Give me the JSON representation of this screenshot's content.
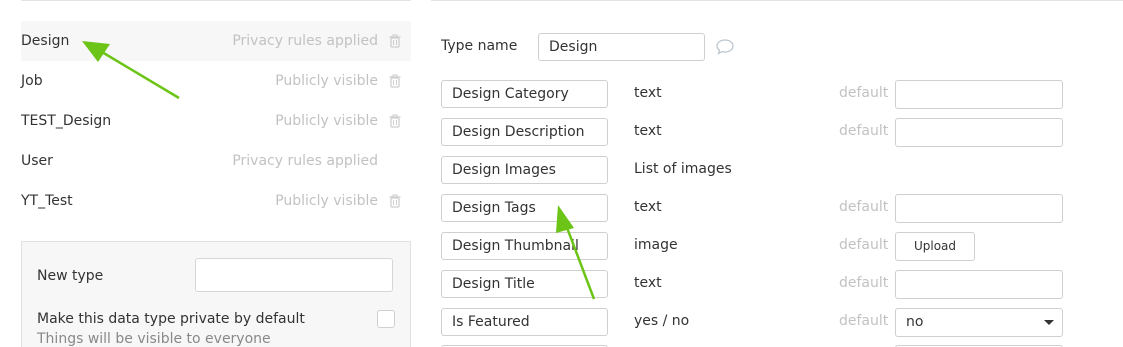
{
  "type_list": {
    "items": [
      {
        "name": "Design",
        "status": "Privacy rules applied",
        "has_trash": true
      },
      {
        "name": "Job",
        "status": "Publicly visible",
        "has_trash": true
      },
      {
        "name": "TEST_Design",
        "status": "Publicly visible",
        "has_trash": true
      },
      {
        "name": "User",
        "status": "Privacy rules applied",
        "has_trash": false
      },
      {
        "name": "YT_Test",
        "status": "Publicly visible",
        "has_trash": true
      }
    ],
    "selected": "Design"
  },
  "new_type": {
    "label": "New type",
    "input_value": "",
    "private_label": "Make this data type private by default",
    "private_sub": "Things will be visible to everyone",
    "private_checked": false
  },
  "detail": {
    "type_name_label": "Type name",
    "type_name_value": "Design",
    "fields": [
      {
        "name": "Design Category",
        "type": "text",
        "default_label": "default",
        "default_kind": "input",
        "default_value": ""
      },
      {
        "name": "Design Description",
        "type": "text",
        "default_label": "default",
        "default_kind": "input",
        "default_value": ""
      },
      {
        "name": "Design Images",
        "type": "List of images",
        "default_label": "",
        "default_kind": "none",
        "default_value": ""
      },
      {
        "name": "Design Tags",
        "type": "text",
        "default_label": "default",
        "default_kind": "input",
        "default_value": ""
      },
      {
        "name": "Design Thumbnail",
        "type": "image",
        "default_label": "default",
        "default_kind": "upload",
        "default_value": "Upload"
      },
      {
        "name": "Design Title",
        "type": "text",
        "default_label": "default",
        "default_kind": "input",
        "default_value": ""
      },
      {
        "name": "Is Featured",
        "type": "yes / no",
        "default_label": "default",
        "default_kind": "select",
        "default_value": "no"
      }
    ]
  },
  "colors": {
    "annotation_arrow": "#6cc417",
    "muted_text": "#c2c2c2",
    "border": "#cfcfcf"
  },
  "icons": [
    "trash-icon",
    "comment-icon",
    "caret-down-icon",
    "arrow-annotation"
  ]
}
